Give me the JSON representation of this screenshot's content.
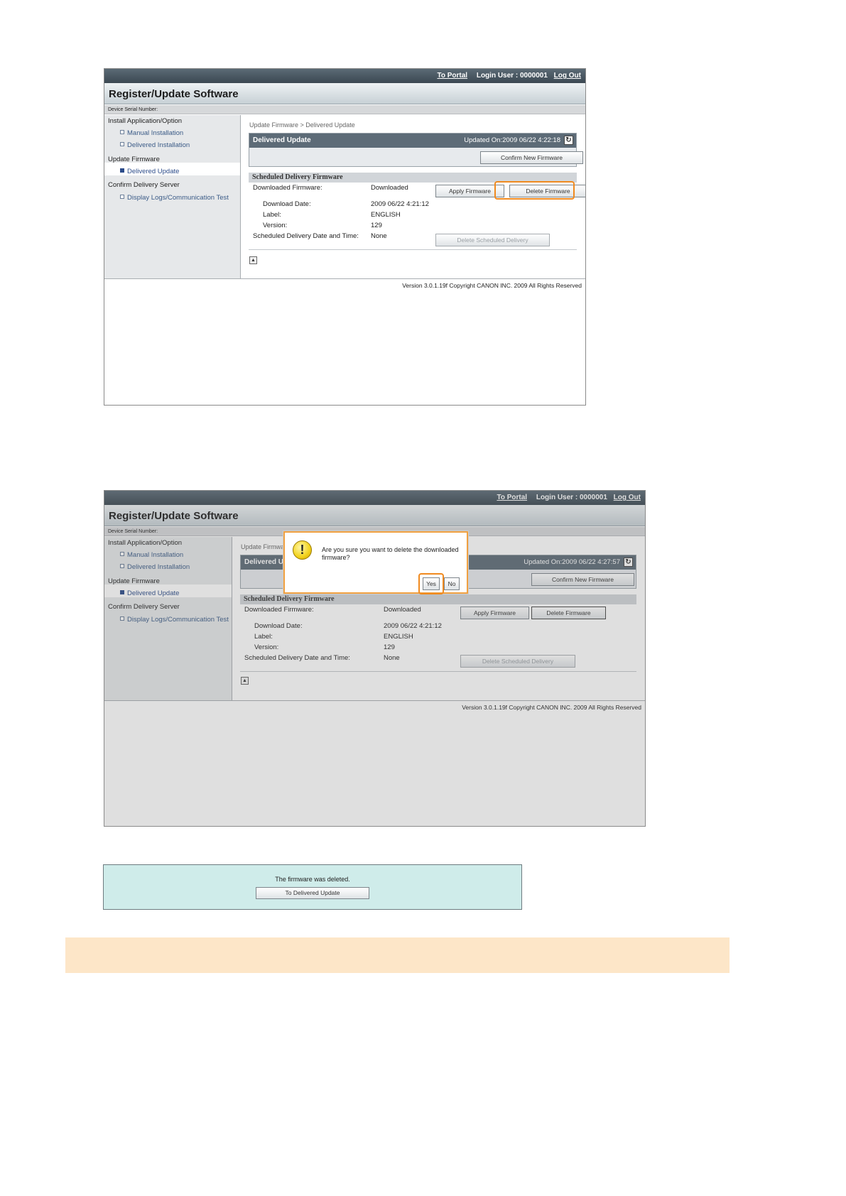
{
  "app": {
    "to_portal": "To Portal",
    "login_user": "Login User : 0000001",
    "log_out": "Log Out",
    "title": "Register/Update Software",
    "serial_label": "Device Serial Number:",
    "footer_version": "Version 3.0.1.19f Copyright CANON INC. 2009 All Rights Reserved"
  },
  "sidebar": {
    "sec_install": "Install Application/Option",
    "item_manual": "Manual Installation",
    "item_delivered_install": "Delivered Installation",
    "sec_update": "Update Firmware",
    "item_delivered_update": "Delivered Update",
    "sec_confirm": "Confirm Delivery Server",
    "item_logs": "Display Logs/Communication Test"
  },
  "main": {
    "breadcrumb": "Update Firmware > Delivered Update",
    "box_title": "Delivered Update",
    "updated_on_1": "Updated On:2009 06/22 4:22:18",
    "updated_on_2": "Updated On:2009 06/22 4:27:57",
    "confirm_new_button": "Confirm New Firmware",
    "sched_title": "Scheduled Delivery Firmware",
    "downloaded_firmware_label": "Downloaded Firmware:",
    "downloaded_firmware_value": "Downloaded",
    "apply_button": "Apply Firmware",
    "delete_button": "Delete Firmware",
    "download_date_label": "Download Date:",
    "download_date_value": "2009 06/22 4:21:12",
    "label_label": "Label:",
    "label_value": "ENGLISH",
    "version_label": "Version:",
    "version_value": "129",
    "sched_date_label": "Scheduled Delivery Date and Time:",
    "sched_date_value": "None",
    "delete_sched_button": "Delete Scheduled Delivery"
  },
  "dialog": {
    "message": "Are you sure you want to delete the downloaded firmware?",
    "yes": "Yes",
    "no": "No"
  },
  "confirmation": {
    "message": "The firmware was deleted.",
    "button": "To Delivered Update"
  },
  "colors": {
    "highlight": "#f08a1f",
    "note_band": "#fde6c8"
  }
}
